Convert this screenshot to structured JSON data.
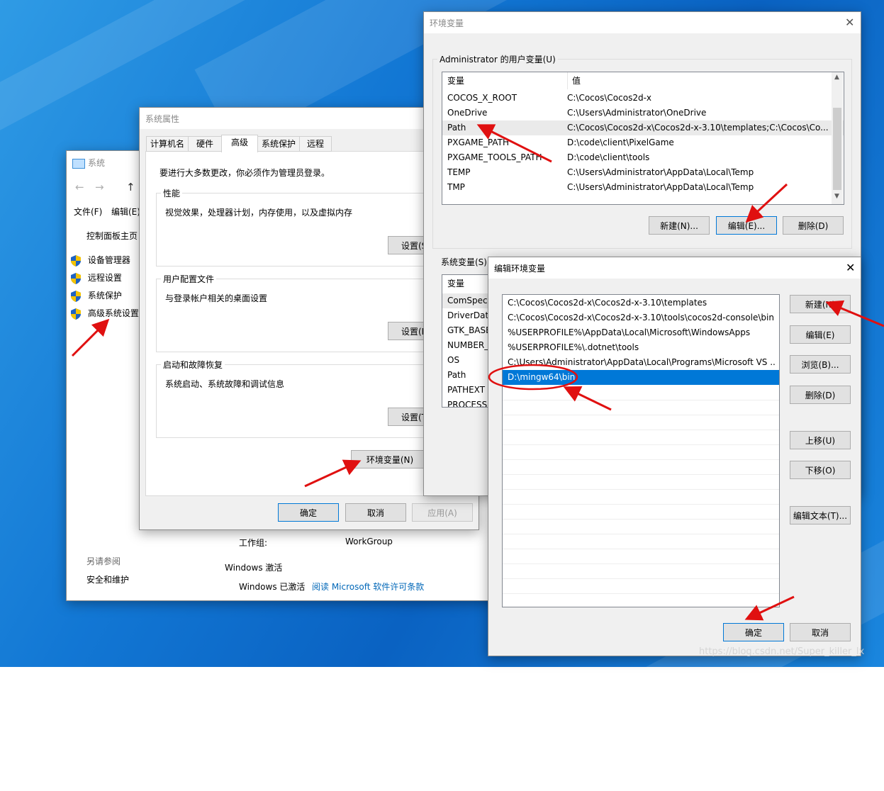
{
  "system_window": {
    "title": "系统",
    "menu": [
      "文件(F)",
      "编辑(E)"
    ],
    "control_panel_home": "控制面板主页",
    "links": [
      "设备管理器",
      "远程设置",
      "系统保护",
      "高级系统设置"
    ],
    "see_also": "另请参阅",
    "security": "安全和维护",
    "workgroup_label": "工作组:",
    "workgroup_value": "WorkGroup",
    "activation_title": "Windows 激活",
    "activation_status": "Windows 已激活",
    "license_link": "阅读 Microsoft 软件许可条款"
  },
  "sysprops": {
    "title": "系统属性",
    "tabs": [
      "计算机名",
      "硬件",
      "高级",
      "系统保护",
      "远程"
    ],
    "admin_note": "要进行大多数更改，你必须作为管理员登录。",
    "perf": {
      "label": "性能",
      "desc": "视觉效果，处理器计划，内存使用，以及虚拟内存",
      "btn": "设置(S"
    },
    "profile": {
      "label": "用户配置文件",
      "desc": "与登录帐户相关的桌面设置",
      "btn": "设置(E"
    },
    "startup": {
      "label": "启动和故障恢复",
      "desc": "系统启动、系统故障和调试信息",
      "btn": "设置(T"
    },
    "env_btn": "环境变量(N)",
    "ok": "确定",
    "cancel": "取消",
    "apply": "应用(A)"
  },
  "envvars": {
    "title": "环境变量",
    "user_section": "Administrator 的用户变量(U)",
    "col_var": "变量",
    "col_val": "值",
    "user_rows": [
      {
        "name": "COCOS_X_ROOT",
        "value": "C:\\Cocos\\Cocos2d-x"
      },
      {
        "name": "OneDrive",
        "value": "C:\\Users\\Administrator\\OneDrive"
      },
      {
        "name": "Path",
        "value": "C:\\Cocos\\Cocos2d-x\\Cocos2d-x-3.10\\templates;C:\\Cocos\\Co..."
      },
      {
        "name": "PXGAME_PATH",
        "value": "D:\\code\\client\\PixelGame"
      },
      {
        "name": "PXGAME_TOOLS_PATH",
        "value": "D:\\code\\client\\tools"
      },
      {
        "name": "TEMP",
        "value": "C:\\Users\\Administrator\\AppData\\Local\\Temp"
      },
      {
        "name": "TMP",
        "value": "C:\\Users\\Administrator\\AppData\\Local\\Temp"
      }
    ],
    "new_btn": "新建(N)...",
    "edit_btn": "编辑(E)...",
    "delete_btn": "删除(D)",
    "sys_section": "系统变量(S)",
    "sys_rows": [
      "ComSpec",
      "DriverData",
      "GTK_BASE",
      "NUMBER_",
      "OS",
      "Path",
      "PATHEXT",
      "PROCESSO"
    ]
  },
  "editenv": {
    "title": "编辑环境变量",
    "entries": [
      "C:\\Cocos\\Cocos2d-x\\Cocos2d-x-3.10\\templates",
      "C:\\Cocos\\Cocos2d-x\\Cocos2d-x-3.10\\tools\\cocos2d-console\\bin",
      "%USERPROFILE%\\AppData\\Local\\Microsoft\\WindowsApps",
      "%USERPROFILE%\\.dotnet\\tools",
      "C:\\Users\\Administrator\\AppData\\Local\\Programs\\Microsoft VS ...",
      "D:\\mingw64\\bin"
    ],
    "selected_index": 5,
    "new_btn": "新建(N)",
    "edit_btn": "编辑(E)",
    "browse_btn": "浏览(B)...",
    "delete_btn": "删除(D)",
    "up_btn": "上移(U)",
    "down_btn": "下移(O)",
    "edit_text_btn": "编辑文本(T)...",
    "ok": "确定",
    "cancel": "取消"
  },
  "watermark": "https://blog.csdn.net/Super_killer_lx",
  "colors": {
    "selection": "#0078d7",
    "annotation": "#e01010",
    "desktop": "#1277d4"
  }
}
